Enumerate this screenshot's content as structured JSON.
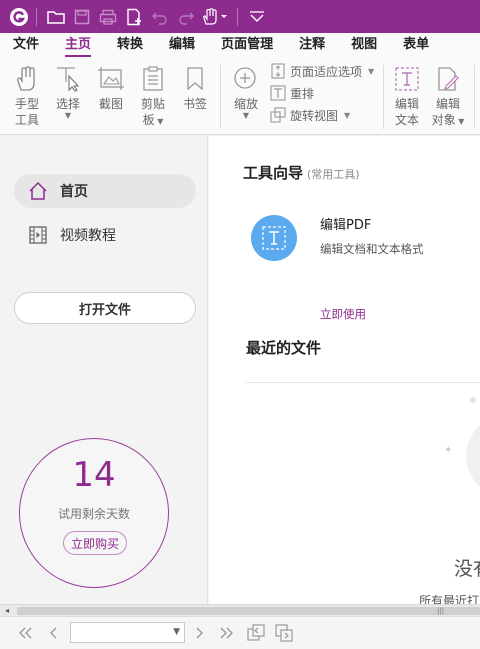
{
  "colors": {
    "accent": "#8e2b8f",
    "tool_circle": "#5ba9ef"
  },
  "titlebar": {
    "icons": [
      "app-logo-icon",
      "open-folder-icon",
      "save-icon",
      "print-icon",
      "new-file-icon",
      "undo-icon",
      "redo-icon",
      "hand-tool-icon",
      "customize-toolbar-icon"
    ]
  },
  "menu": {
    "items": [
      "文件",
      "主页",
      "转换",
      "编辑",
      "页面管理",
      "注释",
      "视图",
      "表单"
    ],
    "active": "主页"
  },
  "ribbon": {
    "hand_line1": "手型",
    "hand_line2": "工具",
    "select_label": "选择",
    "screenshot_label": "截图",
    "clipboard_line1": "剪贴",
    "clipboard_line2": "板",
    "bookmark_label": "书签",
    "zoom_label": "缩放",
    "page_fit_label": "页面适应选项",
    "reflow_label": "重排",
    "rotate_label": "旋转视图",
    "edit_text_line1": "编辑",
    "edit_text_line2": "文本",
    "edit_obj_line1": "编辑",
    "edit_obj_line2": "对象"
  },
  "sidebar": {
    "items": [
      {
        "label": "首页",
        "icon": "home-icon",
        "active": true
      },
      {
        "label": "视频教程",
        "icon": "video-icon",
        "active": false
      }
    ],
    "open_file_label": "打开文件",
    "trial": {
      "days": "14",
      "caption": "试用剩余天数",
      "buy_label": "立即购买"
    }
  },
  "main": {
    "tools_title": "工具向导",
    "tools_subtitle": "(常用工具)",
    "tool_name": "编辑PDF",
    "tool_desc": "编辑文档和文本格式",
    "use_now": "立即使用",
    "recent_title": "最近的文件",
    "empty_text": "没有",
    "empty_sub": "所有最近打"
  },
  "statusbar": {
    "page_value": ""
  }
}
